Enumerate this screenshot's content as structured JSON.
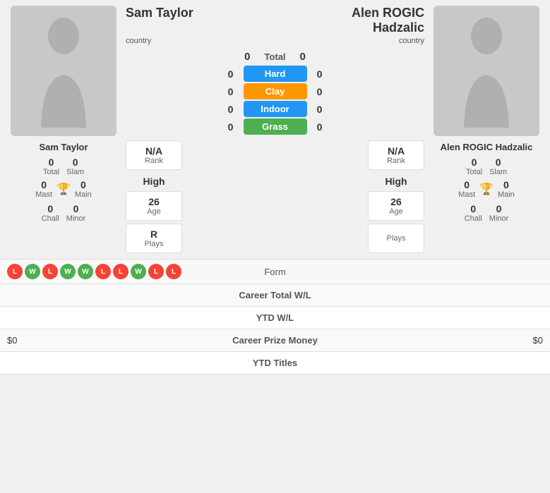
{
  "player1": {
    "name": "Sam Taylor",
    "name_below": "Sam Taylor",
    "country": "country",
    "total": "0",
    "slam": "0",
    "mast": "0",
    "main": "0",
    "chall": "0",
    "minor": "0",
    "rank_label": "N/A",
    "rank_sublabel": "Rank",
    "high_label": "High",
    "age_value": "26",
    "age_label": "Age",
    "plays_value": "R",
    "plays_label": "Plays"
  },
  "player2": {
    "name": "Alen ROGIC Hadzalic",
    "name_line1": "Alen ROGIC",
    "name_line2": "Hadzalic",
    "country": "country",
    "total": "0",
    "slam": "0",
    "mast": "0",
    "main": "0",
    "chall": "0",
    "minor": "0",
    "rank_label": "N/A",
    "rank_sublabel": "Rank",
    "high_label": "High",
    "age_value": "26",
    "age_label": "Age",
    "plays_label": "Plays"
  },
  "surfaces": {
    "total_label": "Total",
    "total_score_left": "0",
    "total_score_right": "0",
    "hard_label": "Hard",
    "hard_left": "0",
    "hard_right": "0",
    "clay_label": "Clay",
    "clay_left": "0",
    "clay_right": "0",
    "indoor_label": "Indoor",
    "indoor_left": "0",
    "indoor_right": "0",
    "grass_label": "Grass",
    "grass_left": "0",
    "grass_right": "0"
  },
  "form": {
    "label": "Form",
    "badges": [
      "L",
      "W",
      "L",
      "W",
      "W",
      "L",
      "L",
      "W",
      "L",
      "L"
    ]
  },
  "bottom_rows": [
    {
      "left": "",
      "center": "Career Total W/L",
      "right": ""
    },
    {
      "left": "",
      "center": "YTD W/L",
      "right": ""
    },
    {
      "left": "$0",
      "center": "Career Prize Money",
      "right": "$0"
    },
    {
      "left": "",
      "center": "YTD Titles",
      "right": ""
    }
  ]
}
